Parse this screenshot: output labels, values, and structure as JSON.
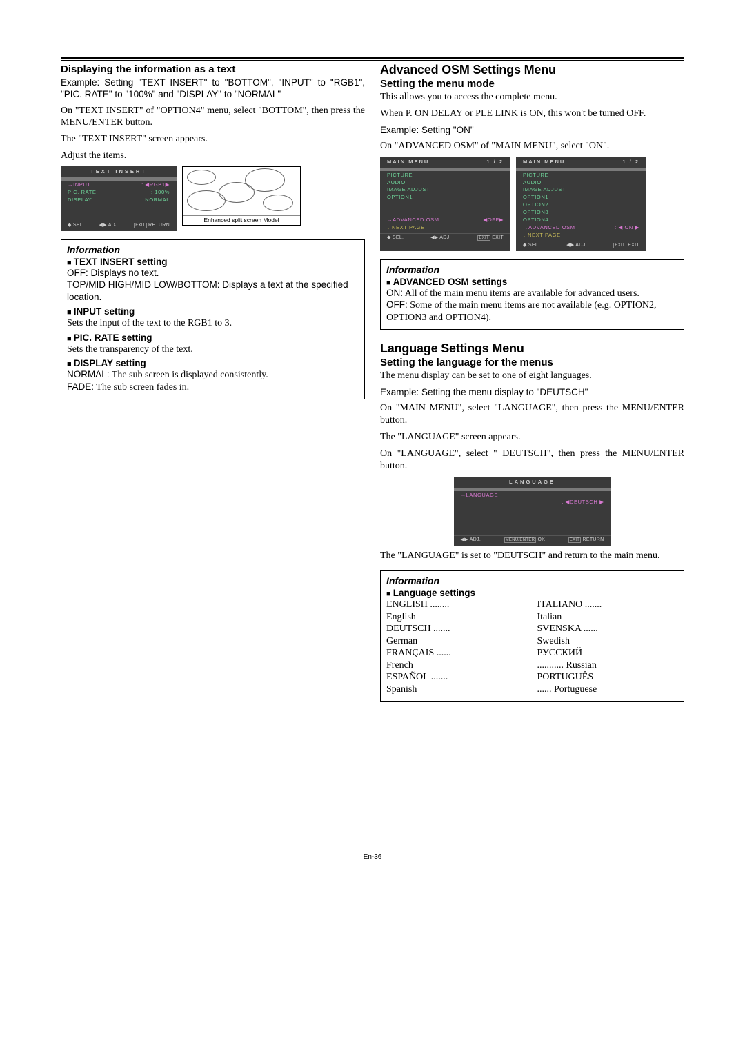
{
  "left": {
    "h3": "Displaying the information as a text",
    "p1": "Example: Setting \"TEXT INSERT\" to \"BOTTOM\", \"INPUT\" to \"RGB1\", \"PIC. RATE\" to \"100%\" and \"DISPLAY\" to \"NORMAL\"",
    "p2": "On \"TEXT INSERT\" of \"OPTION4\" menu, select \"BOTTOM\", then press the MENU/ENTER button.",
    "p3": "The \"TEXT INSERT\" screen appears.",
    "p4": "Adjust the items.",
    "osm1": {
      "title": "TEXT INSERT",
      "r1l": "INPUT",
      "r1r": ": ◀RGB1▶",
      "r2l": "PIC. RATE",
      "r2r": ":   100%",
      "r3l": "DISPLAY",
      "r3r": ":   NORMAL",
      "f1": "◆ SEL.",
      "f2": "◀▶ ADJ.",
      "f3": "EXIT RETURN"
    },
    "diagramLabel": "Enhanced split screen Model",
    "info": {
      "head": "Information",
      "s1": "TEXT INSERT setting",
      "t1a": "OFF: Displays no text.",
      "t1b": "TOP/MID HIGH/MID LOW/BOTTOM: Displays a text at the specified location.",
      "s2": "INPUT setting",
      "t2": "Sets the input of the text to the RGB1 to 3.",
      "s3": "PIC. RATE setting",
      "t3": "Sets the transparency of the text.",
      "s4": "DISPLAY setting",
      "t4a": "NORMAL: The sub screen is displayed consistently.",
      "t4b": "FADE: The sub screen fades in."
    }
  },
  "right": {
    "h2a": "Advanced OSM Settings Menu",
    "h3a": "Setting the menu mode",
    "pa1": "This allows you to access the complete menu.",
    "pa2": "When P. ON DELAY or PLE LINK is ON, this won't be turned OFF.",
    "pa3": "Example: Setting \"ON\"",
    "pa4": "On \"ADVANCED OSM\" of \"MAIN MENU\", select \"ON\".",
    "osmOff": {
      "title": "MAIN MENU",
      "pg": "1 / 2",
      "items": [
        "PICTURE",
        "AUDIO",
        "IMAGE ADJUST",
        "OPTION1"
      ],
      "advL": "ADVANCED OSM",
      "advR": ": ◀OFF▶",
      "next": "↓ NEXT PAGE",
      "f1": "◆ SEL.",
      "f2": "◀▶ ADJ.",
      "f3": "EXIT EXIT"
    },
    "osmOn": {
      "title": "MAIN MENU",
      "pg": "1 / 2",
      "items": [
        "PICTURE",
        "AUDIO",
        "IMAGE ADJUST",
        "OPTION1",
        "OPTION2",
        "OPTION3",
        "OPTION4"
      ],
      "advL": "ADVANCED OSM",
      "advR": ": ◀ ON ▶",
      "next": "↓ NEXT PAGE",
      "f1": "◆ SEL.",
      "f2": "◀▶ ADJ.",
      "f3": "EXIT EXIT"
    },
    "infoA": {
      "head": "Information",
      "s1": "ADVANCED OSM settings",
      "t1": "ON: All of the main menu items are available for advanced users.",
      "t2": "OFF: Some of the main menu items are not available (e.g. OPTION2, OPTION3 and OPTION4)."
    },
    "h2b": "Language Settings Menu",
    "h3b": "Setting the language for the menus",
    "pb1": "The menu display can be set to one of eight languages.",
    "pb2": "Example: Setting the menu display to \"DEUTSCH\"",
    "pb3": "On \"MAIN MENU\", select \"LANGUAGE\", then press the MENU/ENTER button.",
    "pb4": "The \"LANGUAGE\" screen appears.",
    "pb5": "On \"LANGUAGE\", select \" DEUTSCH\", then press the MENU/ENTER button.",
    "osmLang": {
      "title": "LANGUAGE",
      "l": "LANGUAGE",
      "r": ": ◀DEUTSCH ▶",
      "f1": "◀▶ ADJ.",
      "f2": "MENU/ENTER OK",
      "f3": "EXIT RETURN"
    },
    "pb6": "The \"LANGUAGE\" is set to \"DEUTSCH\" and return to the main menu.",
    "infoB": {
      "head": "Information",
      "s1": "Language settings",
      "c1": [
        "ENGLISH ........ English",
        "DEUTSCH ....... German",
        "FRANÇAIS ...... French",
        "ESPAÑOL ....... Spanish"
      ],
      "c2": [
        "ITALIANO ....... Italian",
        "SVENSKA ...... Swedish",
        "РУССКИЙ ........... Russian",
        "PORTUGUÊS ...... Portuguese"
      ]
    }
  },
  "pageNum": "En-36"
}
